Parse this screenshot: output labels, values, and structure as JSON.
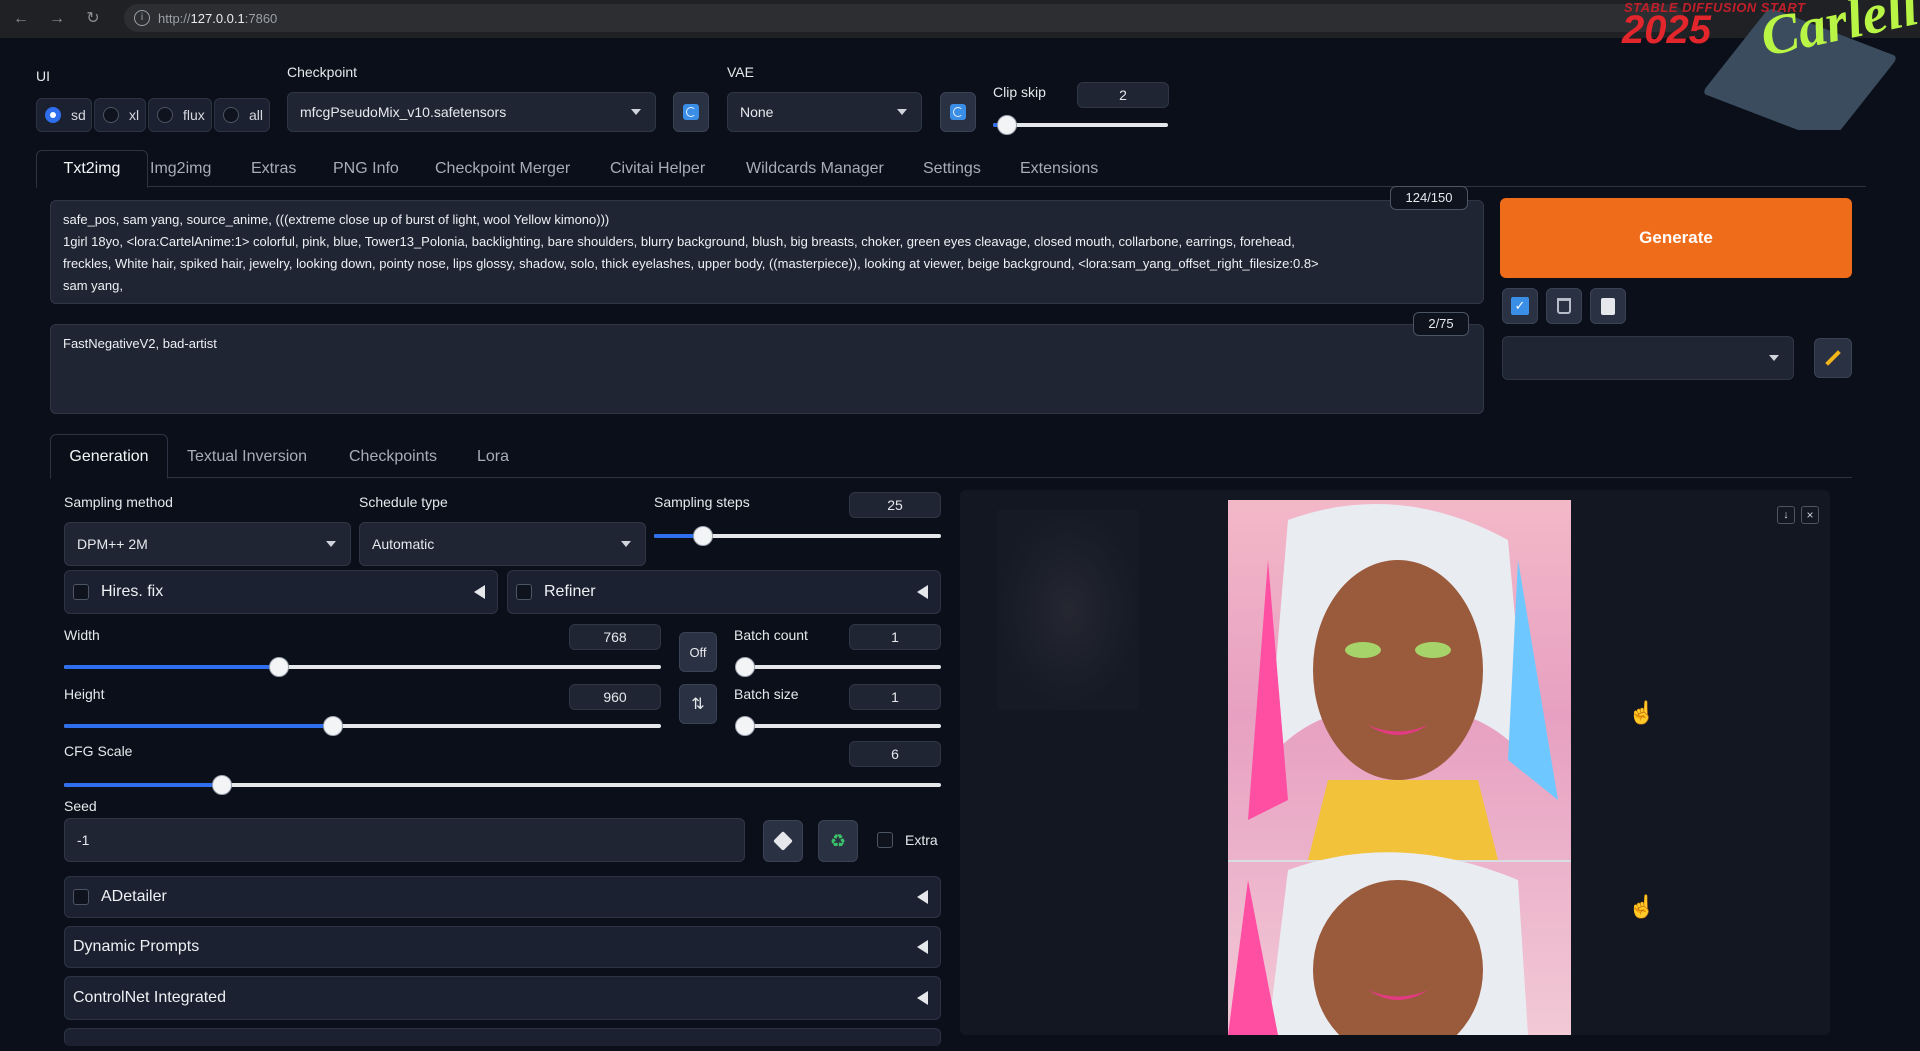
{
  "browser": {
    "url_prefix": "http://",
    "url_host": "127.0.0.1",
    "url_port": ":7860"
  },
  "logo": {
    "line1": "STABLE DIFFUSION START",
    "year": "2025",
    "brand": "Carlell"
  },
  "top": {
    "ui_label": "UI",
    "ui_options": [
      "sd",
      "xl",
      "flux",
      "all"
    ],
    "ui_selected": "sd",
    "checkpoint_label": "Checkpoint",
    "checkpoint_value": "mfcgPseudoMix_v10.safetensors",
    "vae_label": "VAE",
    "vae_value": "None",
    "clip_skip_label": "Clip skip",
    "clip_skip_value": "2",
    "clip_skip_fraction": 0.08
  },
  "tabs": [
    "Txt2img",
    "Img2img",
    "Extras",
    "PNG Info",
    "Checkpoint Merger",
    "Civitai Helper",
    "Wildcards Manager",
    "Settings",
    "Extensions"
  ],
  "active_tab": "Txt2img",
  "prompt": {
    "line1": "safe_pos, sam yang, source_anime, (((extreme close up of burst of light, wool Yellow kimono)))",
    "line2": "1girl 18yo, <lora:CartelAnime:1> colorful, pink, blue, Tower13_Polonia, backlighting, bare shoulders, blurry background, blush, big breasts, choker, green eyes cleavage, closed mouth, collarbone, earrings, forehead,",
    "line3": "freckles, White hair, spiked hair, jewelry, looking down, pointy nose,  lips glossy, shadow, solo, thick eyelashes, upper body, ((masterpiece)), looking at viewer, beige background,  <lora:sam_yang_offset_right_filesize:0.8>",
    "line4": "sam yang,",
    "counter": "124/150"
  },
  "negative": {
    "text": "FastNegativeV2, bad-artist",
    "counter": "2/75"
  },
  "generate_label": "Generate",
  "colors": {
    "generate": "#ef6c1a",
    "accent": "#2f6fed"
  },
  "subtabs": [
    "Generation",
    "Textual Inversion",
    "Checkpoints",
    "Lora"
  ],
  "active_subtab": "Generation",
  "gen": {
    "sampling_method_label": "Sampling method",
    "sampling_method": "DPM++ 2M",
    "schedule_label": "Schedule type",
    "schedule": "Automatic",
    "steps_label": "Sampling steps",
    "steps": "25",
    "steps_fraction": 0.17,
    "hires_label": "Hires. fix",
    "refiner_label": "Refiner",
    "width_label": "Width",
    "width": "768",
    "width_fraction": 0.36,
    "height_label": "Height",
    "height": "960",
    "height_fraction": 0.45,
    "off_label": "Off",
    "batch_count_label": "Batch count",
    "batch_count": "1",
    "batch_count_fraction": 0.0,
    "batch_size_label": "Batch size",
    "batch_size": "1",
    "batch_size_fraction": 0.0,
    "cfg_label": "CFG Scale",
    "cfg": "6",
    "cfg_fraction": 0.18,
    "seed_label": "Seed",
    "seed": "-1",
    "extra_label": "Extra"
  },
  "accordions": [
    "ADetailer",
    "Dynamic Prompts",
    "ControlNet Integrated"
  ]
}
